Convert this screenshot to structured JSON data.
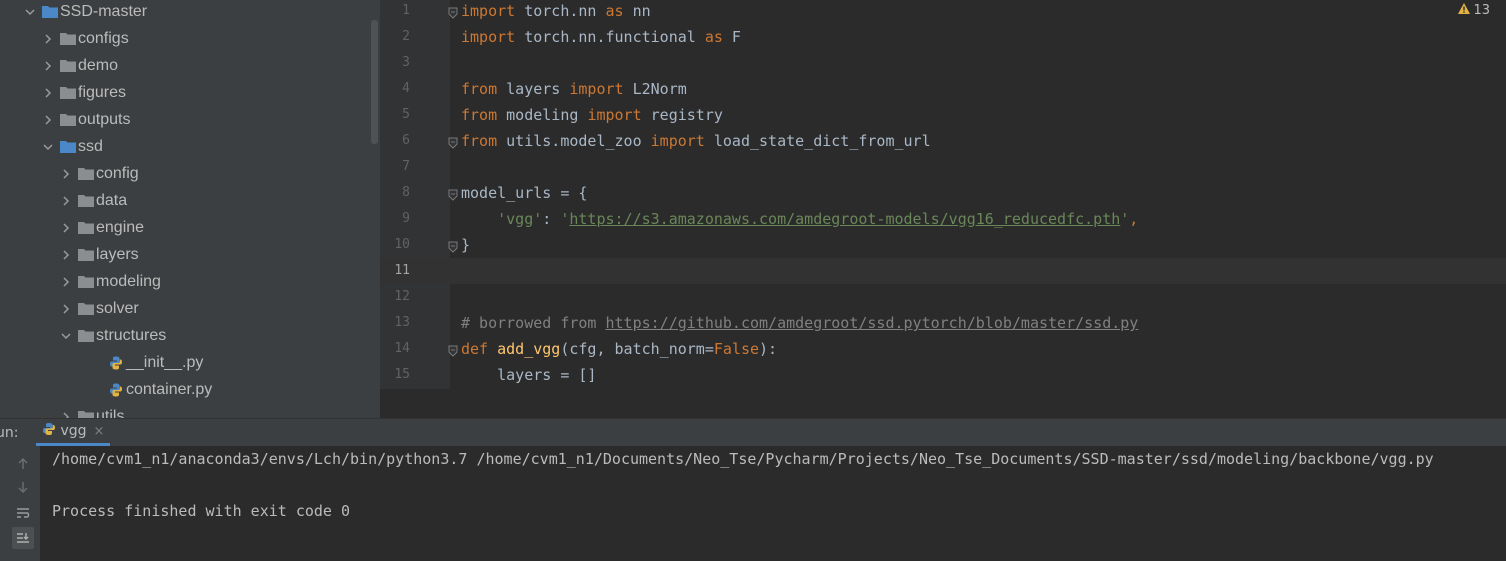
{
  "project_tree": {
    "items": [
      {
        "label": "SSD-master",
        "kind": "folder",
        "expanded": true,
        "depth": 1
      },
      {
        "label": "configs",
        "kind": "folder",
        "expanded": false,
        "depth": 2
      },
      {
        "label": "demo",
        "kind": "folder",
        "expanded": false,
        "depth": 2
      },
      {
        "label": "figures",
        "kind": "folder",
        "expanded": false,
        "depth": 2
      },
      {
        "label": "outputs",
        "kind": "folder",
        "expanded": false,
        "depth": 2
      },
      {
        "label": "ssd",
        "kind": "folder",
        "expanded": true,
        "depth": 2
      },
      {
        "label": "config",
        "kind": "folder",
        "expanded": false,
        "depth": 3
      },
      {
        "label": "data",
        "kind": "folder",
        "expanded": false,
        "depth": 3
      },
      {
        "label": "engine",
        "kind": "folder",
        "expanded": false,
        "depth": 3
      },
      {
        "label": "layers",
        "kind": "folder",
        "expanded": false,
        "depth": 3
      },
      {
        "label": "modeling",
        "kind": "folder",
        "expanded": false,
        "depth": 3
      },
      {
        "label": "solver",
        "kind": "folder",
        "expanded": false,
        "depth": 3
      },
      {
        "label": "structures",
        "kind": "folder",
        "expanded": true,
        "depth": 3
      },
      {
        "label": "__init__.py",
        "kind": "file",
        "depth": 4
      },
      {
        "label": "container.py",
        "kind": "file",
        "depth": 4
      },
      {
        "label": "utils",
        "kind": "folder",
        "expanded": false,
        "depth": 3
      }
    ]
  },
  "editor": {
    "warnings_count": "13",
    "current_line": 11,
    "lines": [
      {
        "n": "1",
        "tokens": [
          [
            "kw",
            "import"
          ],
          [
            "p",
            " torch.nn "
          ],
          [
            "kw",
            "as"
          ],
          [
            "p",
            " nn"
          ]
        ]
      },
      {
        "n": "2",
        "tokens": [
          [
            "kw",
            "import"
          ],
          [
            "p",
            " torch.nn.functional "
          ],
          [
            "kw",
            "as"
          ],
          [
            "p",
            " F"
          ]
        ]
      },
      {
        "n": "3",
        "tokens": []
      },
      {
        "n": "4",
        "tokens": [
          [
            "kw",
            "from"
          ],
          [
            "p",
            " layers "
          ],
          [
            "kw",
            "import"
          ],
          [
            "p",
            " L2Norm"
          ]
        ]
      },
      {
        "n": "5",
        "tokens": [
          [
            "kw",
            "from"
          ],
          [
            "p",
            " modeling "
          ],
          [
            "kw",
            "import"
          ],
          [
            "p",
            " registry"
          ]
        ]
      },
      {
        "n": "6",
        "tokens": [
          [
            "kw",
            "from"
          ],
          [
            "p",
            " utils.model_zoo "
          ],
          [
            "kw",
            "import"
          ],
          [
            "p",
            " load_state_dict_from_url"
          ]
        ]
      },
      {
        "n": "7",
        "tokens": []
      },
      {
        "n": "8",
        "tokens": [
          [
            "p",
            "model_urls = {"
          ]
        ]
      },
      {
        "n": "9",
        "tokens": [
          [
            "p",
            "    "
          ],
          [
            "str",
            "'vgg'"
          ],
          [
            "p",
            ": "
          ],
          [
            "str",
            "'"
          ],
          [
            "url",
            "https://s3.amazonaws.com/amdegroot-models/vgg16_reducedfc.pth"
          ],
          [
            "str",
            "'"
          ],
          [
            "kw",
            ","
          ]
        ]
      },
      {
        "n": "10",
        "tokens": [
          [
            "p",
            "}"
          ]
        ]
      },
      {
        "n": "11",
        "tokens": []
      },
      {
        "n": "12",
        "tokens": []
      },
      {
        "n": "13",
        "tokens": [
          [
            "cmt",
            "# borrowed from "
          ],
          [
            "curl",
            "https://github.com/amdegroot/ssd.pytorch/blob/master/ssd.py"
          ]
        ]
      },
      {
        "n": "14",
        "tokens": [
          [
            "kw",
            "def"
          ],
          [
            "p",
            " "
          ],
          [
            "fn",
            "add_vgg"
          ],
          [
            "p",
            "(cfg, batch_norm="
          ],
          [
            "bool",
            "False"
          ],
          [
            "p",
            "):"
          ]
        ]
      },
      {
        "n": "15",
        "tokens": [
          [
            "p",
            "    layers = []"
          ]
        ]
      }
    ]
  },
  "run_panel": {
    "label": "un:",
    "tab_label": "vgg",
    "tab_close": "×",
    "console_lines": [
      "/home/cvm1_n1/anaconda3/envs/Lch/bin/python3.7 /home/cvm1_n1/Documents/Neo_Tse/Pycharm/Projects/Neo_Tse_Documents/SSD-master/ssd/modeling/backbone/vgg.py",
      "",
      "Process finished with exit code 0"
    ]
  },
  "colors": {
    "folder": "#4a88c7",
    "keyword": "#cc7832",
    "string": "#6a8759",
    "warning": "#e3b341"
  }
}
